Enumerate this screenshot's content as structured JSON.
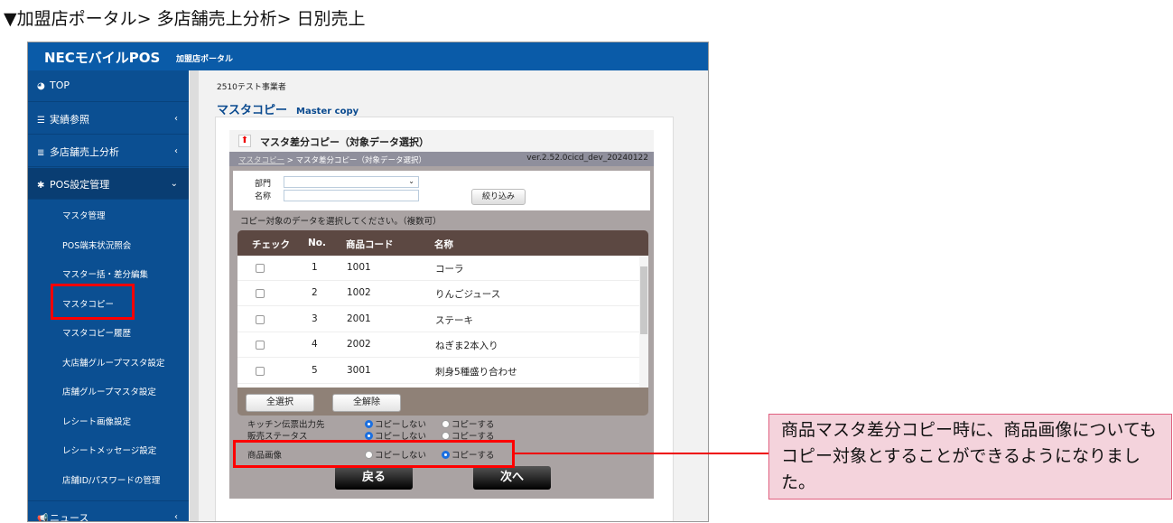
{
  "caption": "▼加盟店ポータル> 多店舗売上分析> 日別売上",
  "header": {
    "logo": "NECモバイルPOS",
    "portal": "加盟店ポータル"
  },
  "sidebar": {
    "items": [
      {
        "label": "TOP",
        "icon": "dashboard-icon"
      },
      {
        "label": "実績参照",
        "icon": "list-icon"
      },
      {
        "label": "多店舗売上分析",
        "icon": "database-icon"
      },
      {
        "label": "POS設定管理",
        "icon": "gear-icon"
      }
    ],
    "subitems": [
      "マスタ管理",
      "POS端末状況照会",
      "マスター括・差分編集",
      "マスタコピー",
      "マスタコピー履歴",
      "大店舗グループマスタ設定",
      "店舗グループマスタ設定",
      "レシート画像設定",
      "レシートメッセージ設定",
      "店舗ID/パスワードの管理"
    ],
    "news": "ニュース"
  },
  "main": {
    "business": "2510テスト事業者",
    "title": "マスタコピー",
    "subtitle": "Master copy",
    "box_title": "マスタ差分コピー（対象データ選択）",
    "breadcrumb_link": "マスタコピー",
    "breadcrumb_current": "> マスタ差分コピー（対象データ選択）",
    "version": "ver.2.52.0cicd_dev_20240122",
    "filter": {
      "dept_label": "部門",
      "dept_value": "",
      "name_label": "名称",
      "name_value": "",
      "button": "絞り込み"
    },
    "instruction": "コピー対象のデータを選択してください。（複数可）",
    "table": {
      "headers": [
        "チェック",
        "No.",
        "商品コード",
        "名称"
      ],
      "rows": [
        {
          "no": "1",
          "code": "1001",
          "name": "コーラ",
          "checked": false
        },
        {
          "no": "2",
          "code": "1002",
          "name": "りんごジュース",
          "checked": false
        },
        {
          "no": "3",
          "code": "2001",
          "name": "ステーキ",
          "checked": false
        },
        {
          "no": "4",
          "code": "2002",
          "name": "ねぎま2本入り",
          "checked": false
        },
        {
          "no": "5",
          "code": "3001",
          "name": "刺身5種盛り合わせ",
          "checked": false
        }
      ]
    },
    "select_all": "全選択",
    "deselect_all": "全解除",
    "options": [
      {
        "label": "キッチン伝票出力先",
        "no": "コピーしない",
        "yes": "コピーする",
        "selected": "no"
      },
      {
        "label": "販売ステータス",
        "no": "コピーしない",
        "yes": "コピーする",
        "selected": "no"
      },
      {
        "label": "商品画像",
        "no": "コピーしない",
        "yes": "コピーする",
        "selected": "yes"
      }
    ],
    "back": "戻る",
    "next": "次へ"
  },
  "callout": {
    "text": "商品マスタ差分コピー時に、商品画像についてもコピー対象とすることができるようになりました。"
  },
  "colors": {
    "header": "#0a5ba8",
    "sidebar": "#0b4f92",
    "highlight": "#ff0000",
    "callout_bg": "#f4d3dc"
  }
}
